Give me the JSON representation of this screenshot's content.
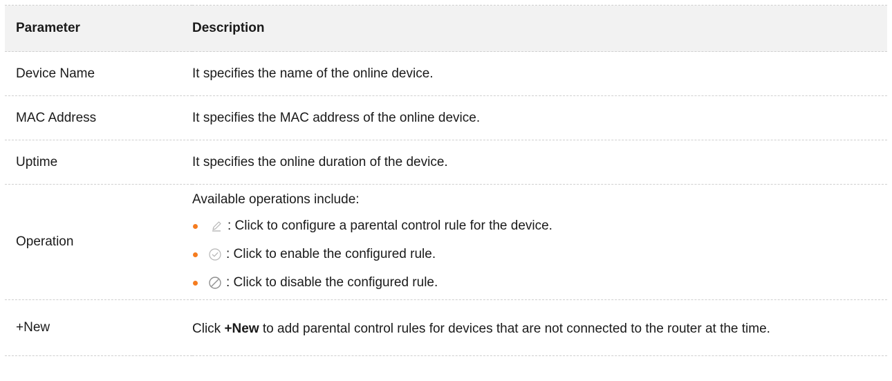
{
  "table": {
    "headers": {
      "parameter": "Parameter",
      "description": "Description"
    },
    "rows": [
      {
        "parameter": "Device Name",
        "description": "It specifies the name of the online device."
      },
      {
        "parameter": "MAC Address",
        "description": "It specifies the MAC address of the online device."
      },
      {
        "parameter": "Uptime",
        "description": "It specifies the online duration of the device."
      }
    ],
    "operation": {
      "parameter": "Operation",
      "intro": "Available operations include:",
      "items": [
        {
          "icon": "edit-pencil-icon",
          "text": ": Click to configure a parental control rule for the device."
        },
        {
          "icon": "check-circle-icon",
          "text": ": Click to enable the configured rule."
        },
        {
          "icon": "disable-circle-icon",
          "text": ": Click to disable the configured rule."
        }
      ]
    },
    "new_row": {
      "parameter": "+New",
      "prefix": "Click ",
      "keyword": "+New",
      "suffix": " to add parental control rules for devices that are not connected to the router at the time."
    }
  },
  "colors": {
    "bullet": "#f57c1f",
    "header_bg": "#f2f2f2",
    "icon_gray": "#9a9a9a"
  }
}
